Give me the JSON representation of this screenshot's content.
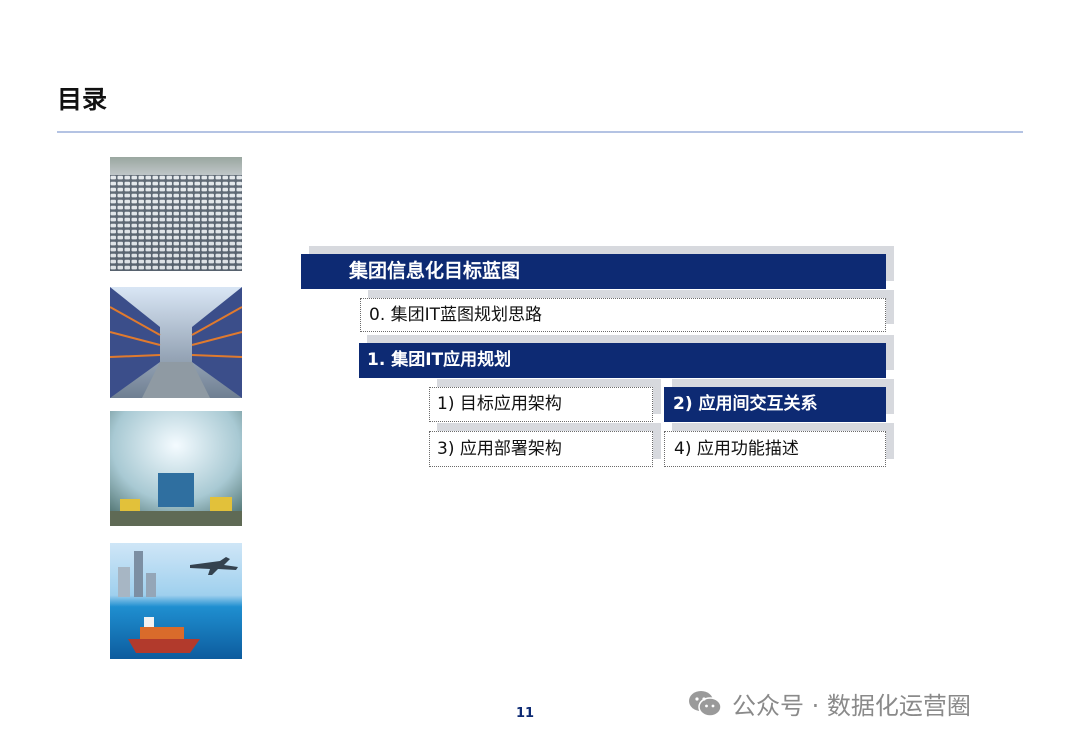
{
  "page": {
    "title": "目录",
    "page_number": "11"
  },
  "photos": [
    {
      "name": "car-parking-lot-photo"
    },
    {
      "name": "warehouse-shelves-photo"
    },
    {
      "name": "factory-hall-photo"
    },
    {
      "name": "port-ship-plane-photo"
    }
  ],
  "toc": {
    "section": "集团信息化目标蓝图",
    "items": [
      "0. 集团IT蓝图规划思路",
      "1. 集团IT应用规划"
    ],
    "subitems": [
      "1) 目标应用架构",
      "2) 应用间交互关系",
      "3) 应用部署架构",
      "4) 应用功能描述"
    ]
  },
  "colors": {
    "accent": "#0d2a73",
    "rule": "#b4c3e3"
  },
  "watermark": {
    "icon": "wechat-icon",
    "text": "公众号 · 数据化运营圈"
  }
}
